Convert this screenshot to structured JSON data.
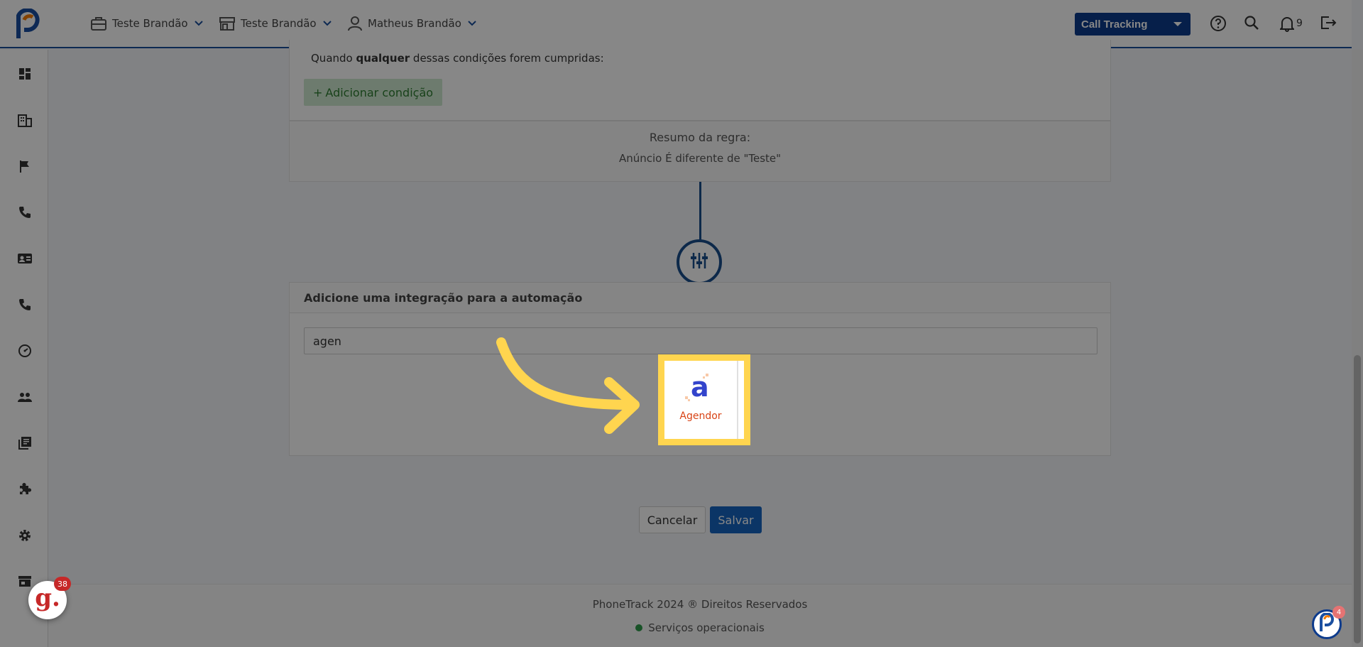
{
  "header": {
    "company": "Teste Brandão",
    "store": "Teste Brandão",
    "user": "Matheus Brandão",
    "product_select": "Call Tracking",
    "notification_count": "9"
  },
  "sidebar": {
    "items": [
      "dashboard-icon",
      "building-icon",
      "flag-icon",
      "phone-icon",
      "contact-card-icon",
      "phone-icon",
      "speed-icon",
      "people-icon",
      "library-icon",
      "puzzle-icon",
      "gear-icon",
      "store-icon"
    ]
  },
  "conditions": {
    "prefix": "Quando ",
    "emphasis": "qualquer",
    "suffix": " dessas condições forem cumpridas:",
    "add_label": "Adicionar condição"
  },
  "summary": {
    "title": "Resumo da regra:",
    "text": "Anúncio É diferente de \"Teste\""
  },
  "integration": {
    "title": "Adicione uma integração para a automação",
    "search_value": "agen",
    "result_label": "Agendor"
  },
  "actions": {
    "cancel": "Cancelar",
    "save": "Salvar"
  },
  "footer": {
    "copyright": "PhoneTrack 2024 ® Direitos Reservados",
    "status": "Serviços operacionais"
  },
  "badges": {
    "g_count": "38",
    "chat_count": "4"
  },
  "colors": {
    "brand": "#0d3b8c",
    "save": "#1565c0",
    "highlight": "#ffd54f",
    "agendor_text": "#d84315"
  }
}
